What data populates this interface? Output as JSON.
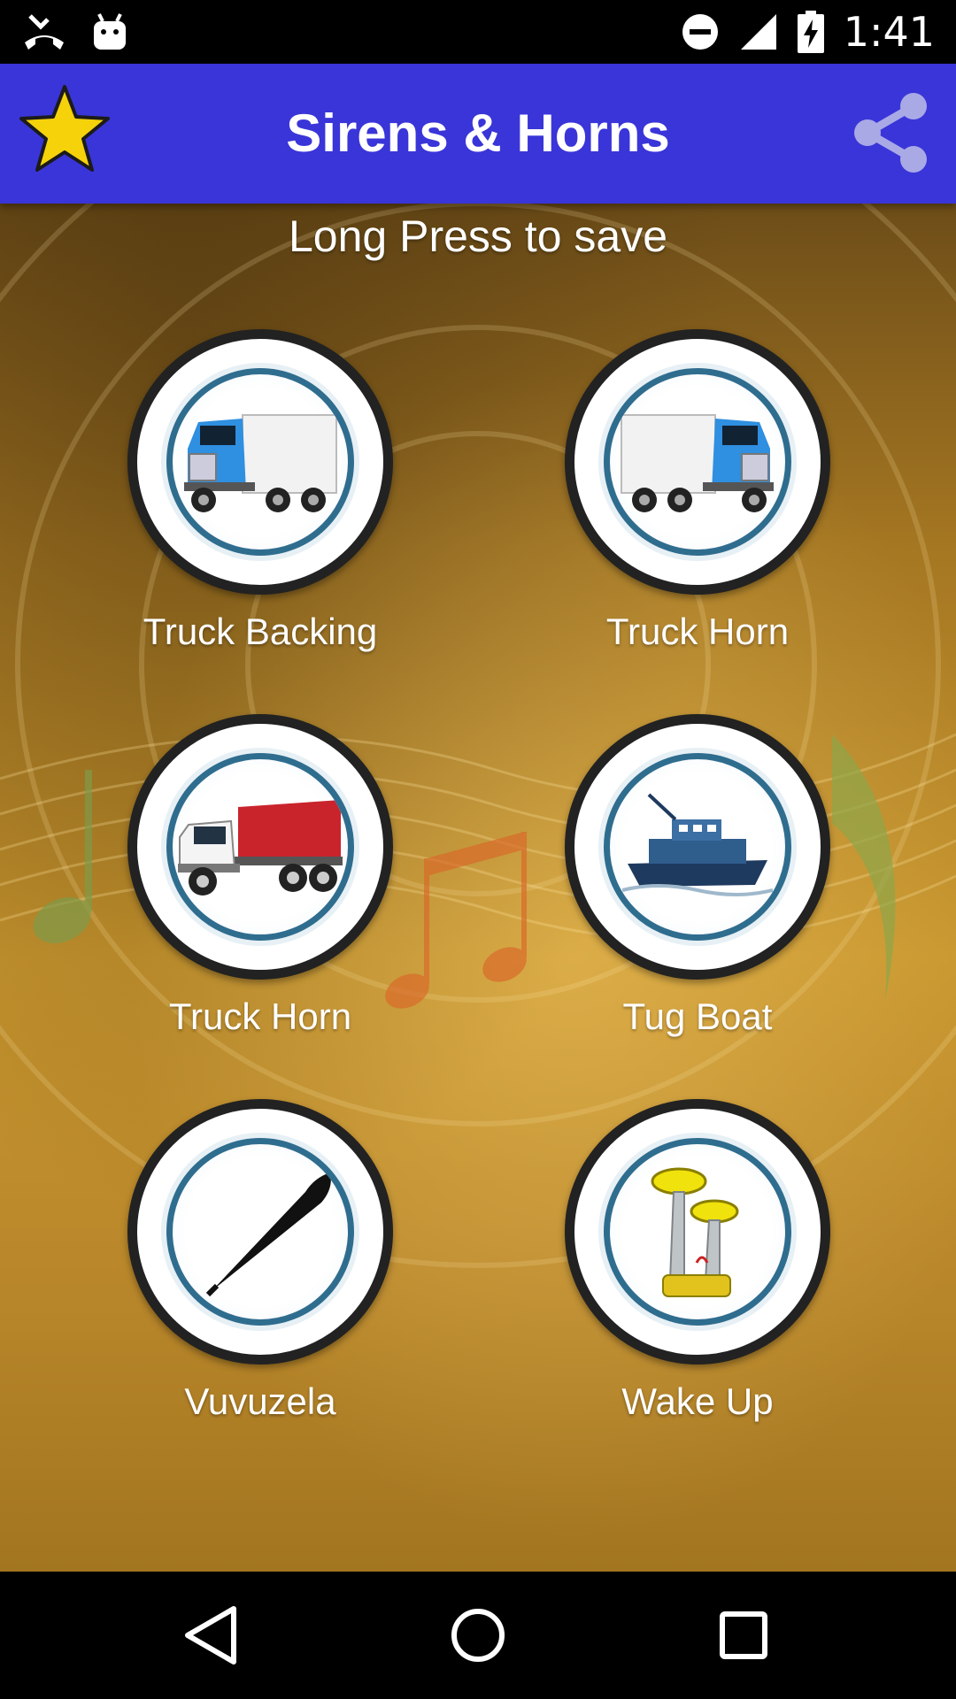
{
  "status_bar": {
    "time": "1:41",
    "icons": [
      "missed-call-icon",
      "android-icon",
      "do-not-disturb-icon",
      "signal-icon",
      "battery-charging-icon"
    ]
  },
  "app_bar": {
    "title": "Sirens & Horns",
    "left_icon": "star-icon",
    "right_icon": "share-icon",
    "color": "#3a35d8"
  },
  "hint": "Long Press to save",
  "sounds": [
    {
      "label": "Truck Backing",
      "icon": "blue-truck-icon"
    },
    {
      "label": "Truck Horn",
      "icon": "blue-truck-icon"
    },
    {
      "label": "Truck Horn",
      "icon": "dump-truck-icon"
    },
    {
      "label": "Tug Boat",
      "icon": "tug-boat-icon"
    },
    {
      "label": "Vuvuzela",
      "icon": "vuvuzela-icon"
    },
    {
      "label": "Wake Up",
      "icon": "air-horn-icon"
    }
  ],
  "nav_bar": {
    "buttons": [
      "back-icon",
      "home-icon",
      "recents-icon"
    ]
  }
}
